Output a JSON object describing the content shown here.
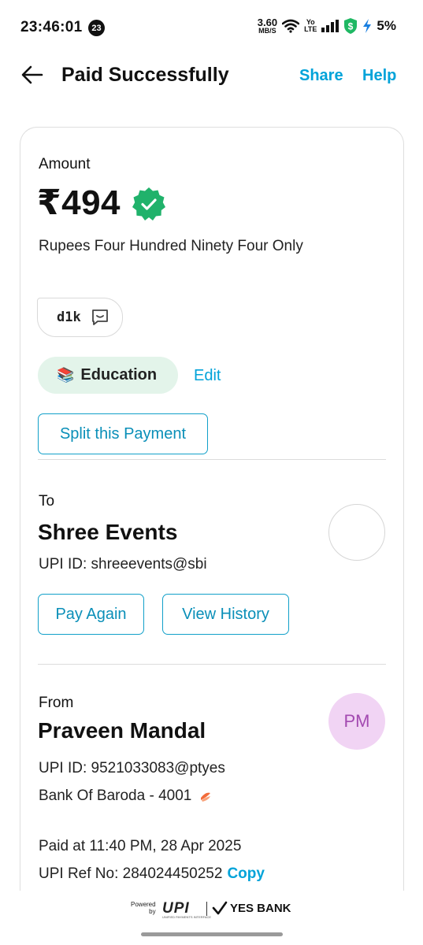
{
  "status_bar": {
    "time": "23:46:01",
    "notification_count": "23",
    "net_speed_value": "3.60",
    "net_speed_unit": "MB/S",
    "volte_top": "Yo",
    "volte_bottom": "LTE",
    "battery_percent": "5%"
  },
  "header": {
    "title": "Paid Successfully",
    "share_label": "Share",
    "help_label": "Help"
  },
  "payment": {
    "amount_label": "Amount",
    "amount_value": "₹494",
    "amount_words": "Rupees Four Hundred Ninety Four Only",
    "note": "d1k",
    "category_emoji": "📚",
    "category": "Education",
    "edit_label": "Edit",
    "split_label": "Split this Payment"
  },
  "to": {
    "label": "To",
    "name": "Shree Events",
    "upi_id": "UPI ID: shreeevents@sbi",
    "pay_again_label": "Pay Again",
    "view_history_label": "View History"
  },
  "from": {
    "label": "From",
    "name": "Praveen Mandal",
    "initials": "PM",
    "upi_id": "UPI ID: 9521033083@ptyes",
    "bank": "Bank Of Baroda - 4001"
  },
  "transaction": {
    "paid_at": "Paid at 11:40 PM, 28 Apr 2025",
    "ref_no": "UPI Ref No: 284024450252",
    "copy_label": "Copy"
  },
  "footer": {
    "powered_by_1": "Powered",
    "powered_by_2": "by",
    "upi_logo": "UPI",
    "upi_tagline": "UNIFIED PAYMENTS INTERFACE",
    "bank_name": "YES BANK"
  },
  "colors": {
    "accent": "#00a3d9",
    "verified_green": "#20b26b",
    "category_bg": "#e3f4ea",
    "avatar_bg": "#f1d4f4",
    "avatar_text": "#a34ab1"
  },
  "icons": {
    "back": "arrow-left-icon",
    "verified": "verified-badge-icon",
    "note": "chat-bubble-icon",
    "wifi": "wifi-icon",
    "signal": "signal-icon",
    "shield": "shield-icon",
    "charging": "charging-bolt-icon",
    "bank": "bank-of-baroda-logo-icon",
    "yes_bank_check": "check-icon"
  }
}
